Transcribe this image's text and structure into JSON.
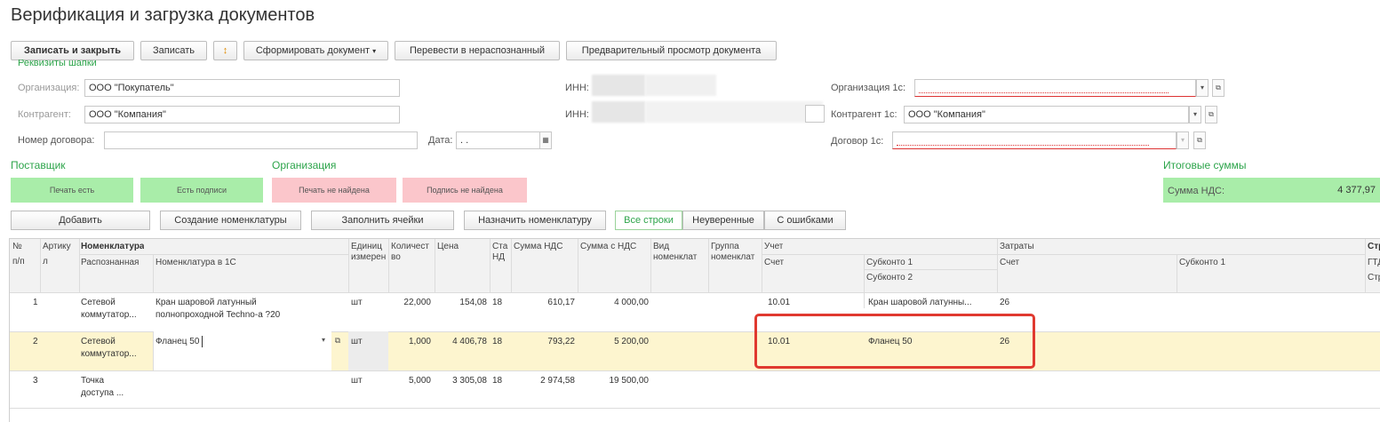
{
  "page": {
    "title": "Верификация и загрузка документов"
  },
  "toolbar": {
    "save_close": "Записать и закрыть",
    "save": "Записать",
    "form_doc": "Сформировать документ",
    "move_unrec": "Перевести в нераспознанный",
    "preview": "Предварительный просмотр документа"
  },
  "requisites": {
    "header": "Реквизиты шапки"
  },
  "form": {
    "org_label": "Организация:",
    "org_value": "ООО \"Покупатель\"",
    "contr_label": "Контрагент:",
    "contr_value": "ООО \"Компания\"",
    "contract_label": "Номер договора:",
    "contract_value": "",
    "date_label": "Дата:",
    "date_value": " .  .",
    "inn_label": "ИНН:",
    "inn2_label": "ИНН:",
    "org1c_label": "Организация 1с:",
    "org1c_value": "",
    "contr1c_label": "Контрагент 1с:",
    "contr1c_value": "ООО \"Компания\"",
    "contract1c_label": "Договор 1с:",
    "contract1c_value": ""
  },
  "sections": {
    "supplier": "Поставщик",
    "organization": "Организация",
    "totals": "Итоговые суммы"
  },
  "status": {
    "supplier_stamp": "Печать есть",
    "supplier_sign": "Есть подписи",
    "org_stamp": "Печать не найдена",
    "org_sign": "Подпись не найдена"
  },
  "totals": {
    "vat_label": "Сумма НДС:",
    "vat_value": "4 377,97"
  },
  "table_toolbar": {
    "add": "Добавить",
    "create_nom": "Создание номенклатуры",
    "fill_cells": "Заполнить ячейки",
    "assign_nom": "Назначить номенклатуру",
    "all_rows": "Все строки",
    "uncertain": "Неуверенные",
    "with_errors": "С ошибками"
  },
  "columns": {
    "num": "№ п/п",
    "num1": "№",
    "num2": "п/п",
    "article1": "Артику",
    "article2": "л",
    "nomenclature": "Номенклатура",
    "recognized": "Распознанная",
    "nom1c": "Номенклатура в 1С",
    "unit1": "Единиц",
    "unit2": "измерен",
    "qty1": "Количест",
    "qty2": "во",
    "price": "Цена",
    "vat_rate1": "Ста",
    "vat_rate2": "НД",
    "vat_sum": "Сумма НДС",
    "sum_vat": "Сумма с НДС",
    "type1": "Вид",
    "type2": "номенклат",
    "group1": "Группа",
    "group2": "номенклат",
    "account_group": "Учет",
    "account": "Счет",
    "subconto1": "Субконто 1",
    "subconto2": "Субконто 2",
    "costs_group": "Затраты",
    "cost_account": "Счет",
    "cost_subconto1": "Субконто 1",
    "extra1": "Стр",
    "extra2": "ГТД",
    "extra3": "Стр"
  },
  "rows": [
    {
      "num": "1",
      "recognized": "Сетевой коммутатор...",
      "recognized1": "Сетевой",
      "recognized2": "коммутатор...",
      "nom1c_1": "Кран шаровой латунный",
      "nom1c_2": "полнопроходной Techno-a ?20",
      "unit": "шт",
      "qty": "22,000",
      "price": "154,08",
      "rate": "18",
      "vat": "610,17",
      "sum": "4 000,00",
      "account": "10.01",
      "subconto1": "Кран шаровой латунны...",
      "cost_account": "26"
    },
    {
      "num": "2",
      "recognized1": "Сетевой",
      "recognized2": "коммутатор...",
      "nom1c_1": "Фланец 50",
      "nom1c_2": "",
      "unit": "шт",
      "qty": "1,000",
      "price": "4 406,78",
      "rate": "18",
      "vat": "793,22",
      "sum": "5 200,00",
      "account": "10.01",
      "subconto1": "Фланец 50",
      "cost_account": "26"
    },
    {
      "num": "3",
      "recognized1": "Точка",
      "recognized2": "доступа ...",
      "nom1c_1": "",
      "nom1c_2": "",
      "unit": "шт",
      "qty": "5,000",
      "price": "3 305,08",
      "rate": "18",
      "vat": "2 974,58",
      "sum": "19 500,00",
      "account": "",
      "subconto1": "",
      "cost_account": ""
    }
  ],
  "colors": {
    "accent_green": "#2ca44a",
    "status_green": "#a9eda9",
    "status_pink": "#fbc6cb",
    "highlight_row": "#fdf5cf",
    "annotation_red": "#e0392f"
  }
}
